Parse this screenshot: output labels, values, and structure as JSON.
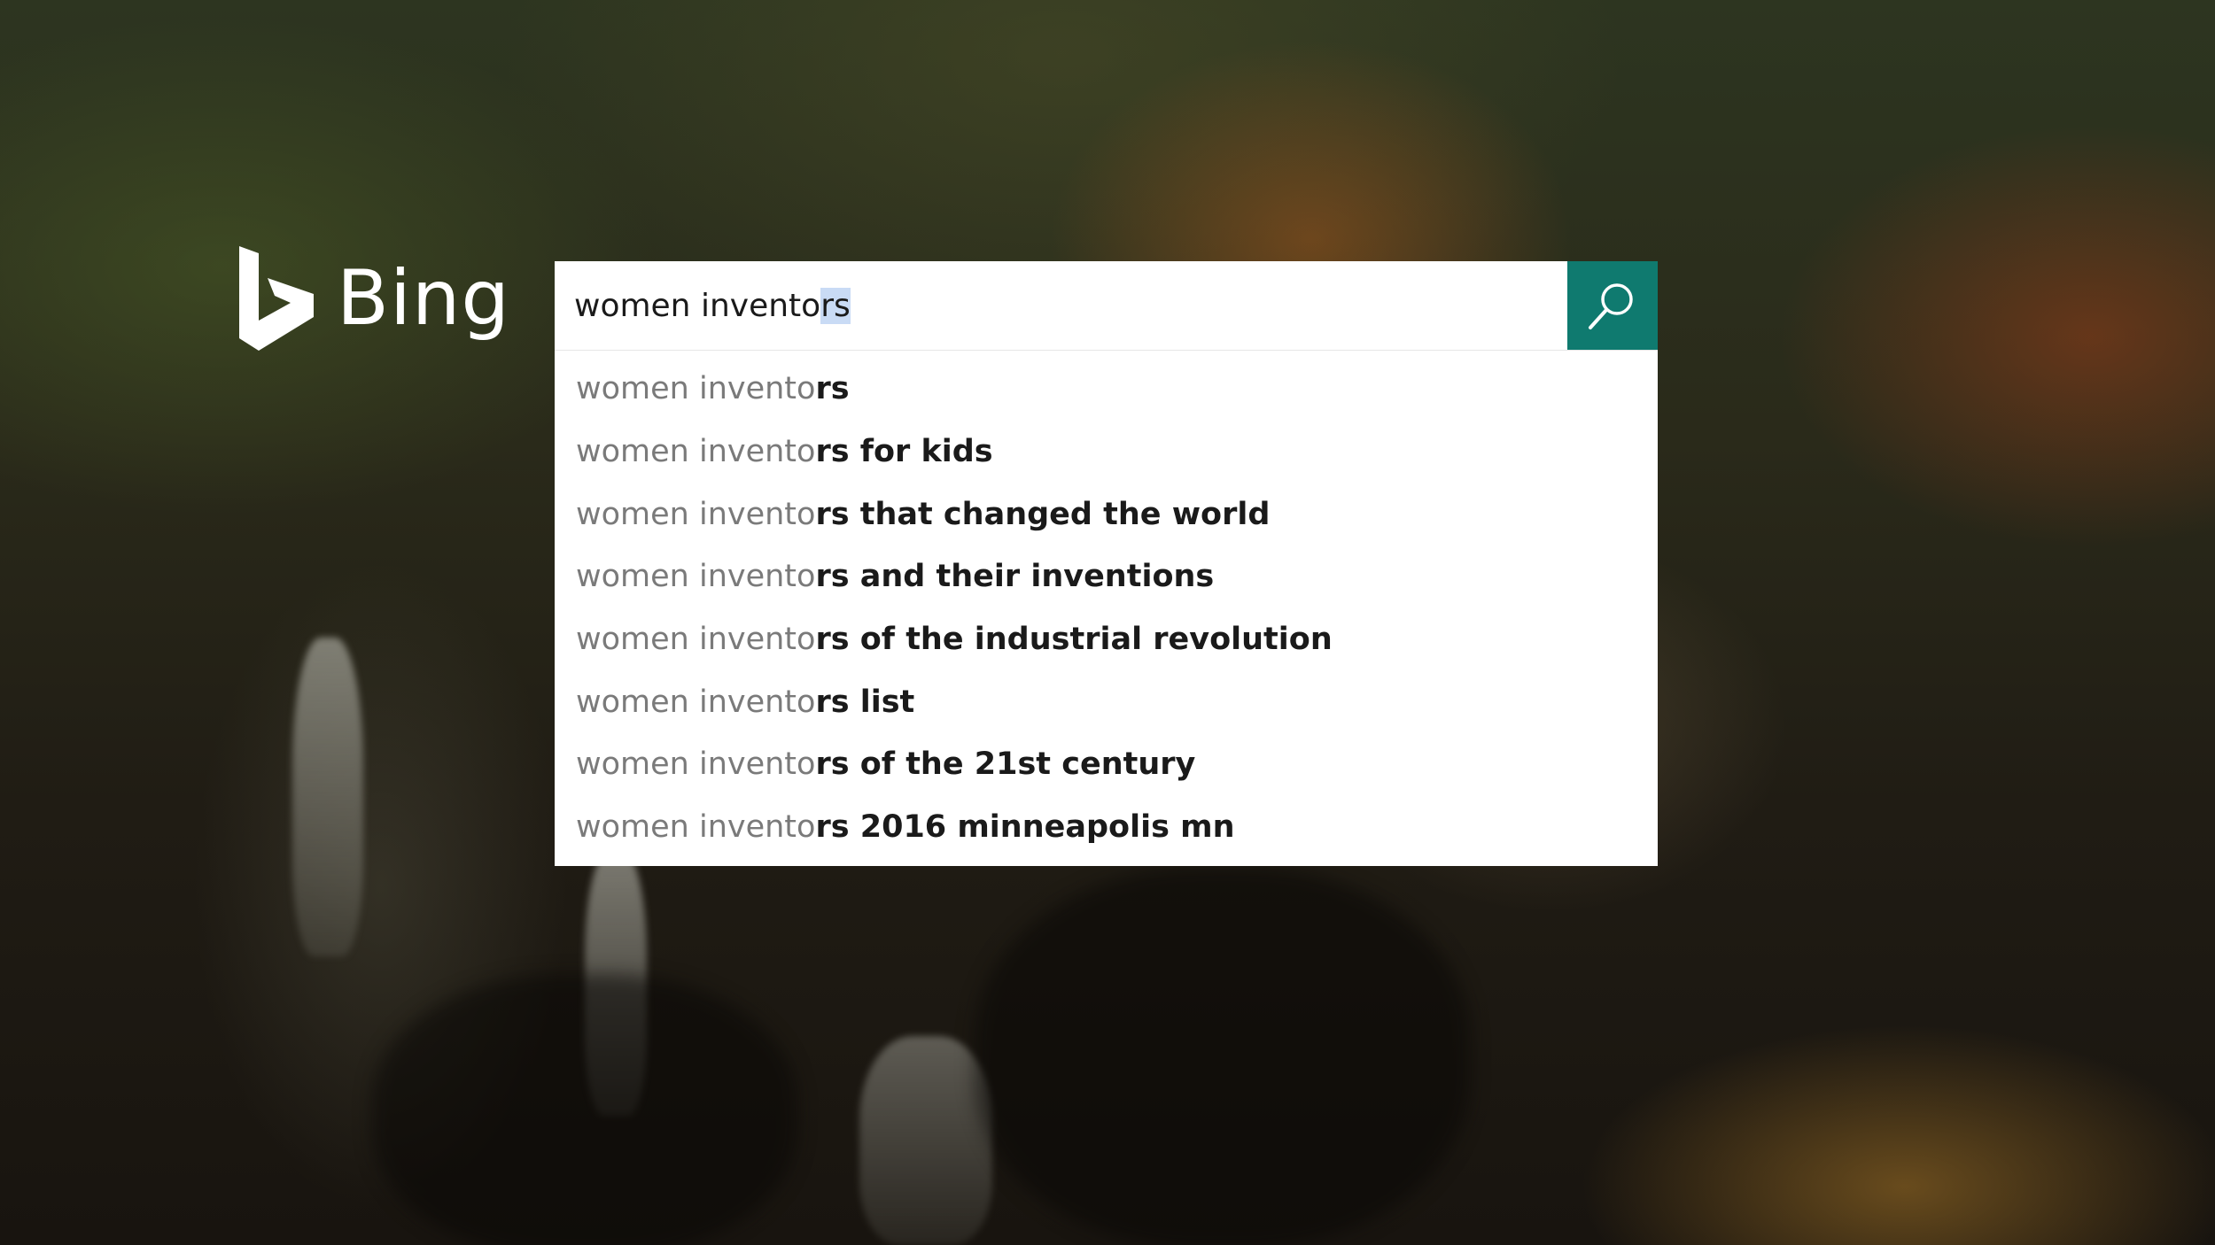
{
  "brand": {
    "name": "Bing",
    "logo_icon": "bing-b-icon",
    "accent_color": "#0f7a6f"
  },
  "search": {
    "typed_prefix": "women invento",
    "selected_completion": "rs",
    "button_icon": "search-icon"
  },
  "suggestions": [
    {
      "prefix": "women invento",
      "completion": "rs"
    },
    {
      "prefix": "women invento",
      "completion": "rs for kids"
    },
    {
      "prefix": "women invento",
      "completion": "rs that changed the world"
    },
    {
      "prefix": "women invento",
      "completion": "rs and their inventions"
    },
    {
      "prefix": "women invento",
      "completion": "rs of the industrial revolution"
    },
    {
      "prefix": "women invento",
      "completion": "rs list"
    },
    {
      "prefix": "women invento",
      "completion": "rs of the 21st century"
    },
    {
      "prefix": "women invento",
      "completion": "rs 2016 minneapolis mn"
    }
  ]
}
